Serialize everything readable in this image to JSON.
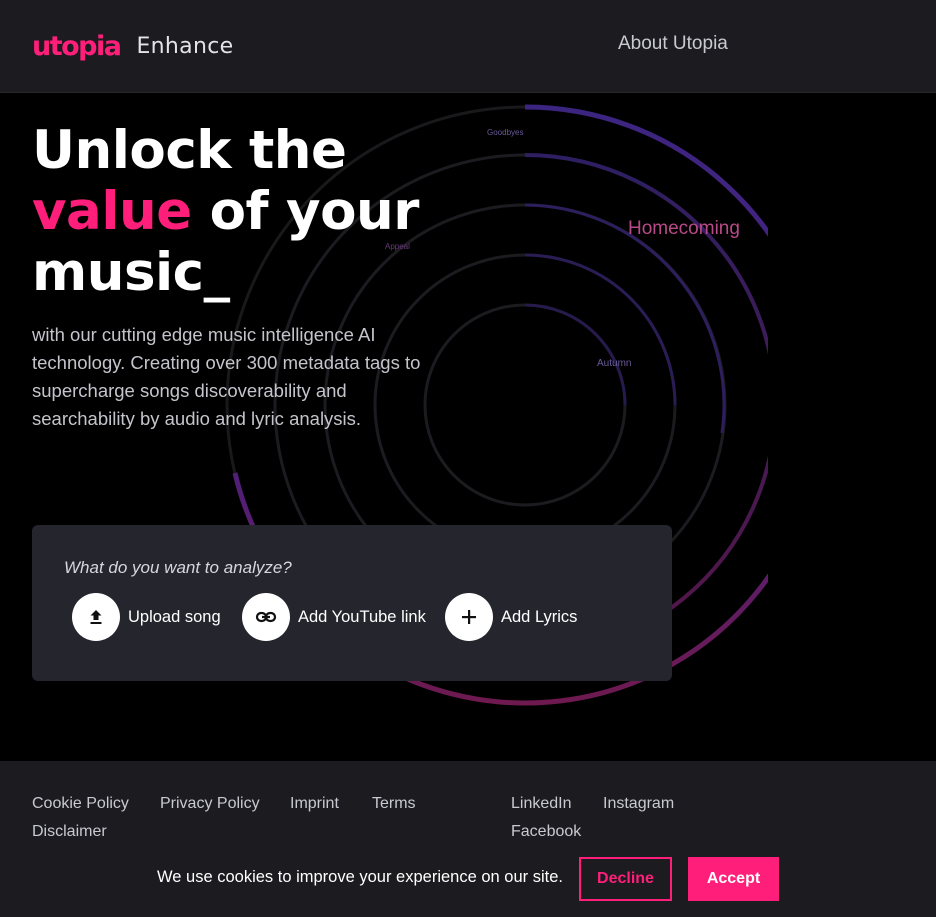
{
  "header": {
    "logo": "utopia",
    "product": "Enhance",
    "nav_about": "About Utopia"
  },
  "hero": {
    "title_line1": "Unlock the",
    "title_accent": "value",
    "title_line2_rest": " of your",
    "title_line3": "music_",
    "description": "with our cutting edge music intelligence AI technology. Creating over 300 metadata tags to supercharge songs discoverability and searchability by audio and lyric analysis.",
    "tags": [
      "Goodbyes",
      "Homecoming",
      "Appeal",
      "Autumn"
    ]
  },
  "analyze": {
    "question": "What do you want to analyze?",
    "actions": [
      {
        "label": "Upload song",
        "icon": "upload-icon"
      },
      {
        "label": "Add YouTube link",
        "icon": "link-icon"
      },
      {
        "label": "Add Lyrics",
        "icon": "plus-icon"
      }
    ]
  },
  "footer": {
    "links": [
      "Cookie Policy",
      "Privacy Policy",
      "Imprint",
      "Terms",
      "Disclaimer"
    ],
    "social": [
      "LinkedIn",
      "Instagram",
      "Facebook"
    ]
  },
  "cookie": {
    "message": "We use cookies to improve your experience on our site.",
    "decline": "Decline",
    "accept": "Accept"
  },
  "colors": {
    "accent": "#ff1f7a",
    "header_bg": "#1b1b20",
    "card_bg": "#25252d",
    "ring_purple": "#3f2380",
    "ring_magenta": "#7a1a55"
  }
}
